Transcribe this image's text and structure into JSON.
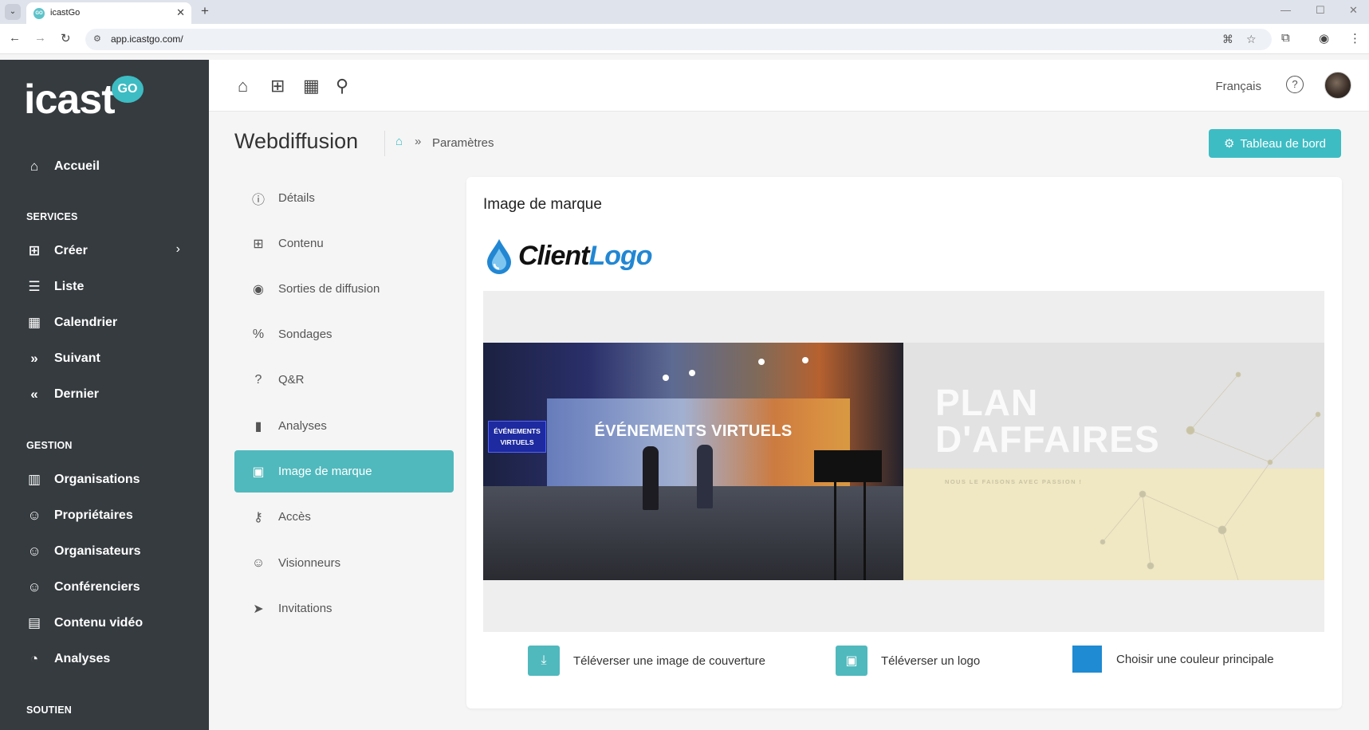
{
  "browser": {
    "tab_title": "icastGo",
    "url": "app.icastgo.com/",
    "favicon_text": "GO"
  },
  "sidebar": {
    "logo_text": "icast",
    "logo_badge": "GO",
    "items_top": [
      {
        "label": "Accueil",
        "icon": "home-icon"
      }
    ],
    "section_services": "SERVICES",
    "items_services": [
      {
        "label": "Créer",
        "icon": "file-plus-icon"
      },
      {
        "label": "Liste",
        "icon": "list-icon"
      },
      {
        "label": "Calendrier",
        "icon": "calendar-icon"
      },
      {
        "label": "Suivant",
        "icon": "chevrons-right-icon"
      },
      {
        "label": "Dernier",
        "icon": "chevrons-left-icon"
      }
    ],
    "section_gestion": "GESTION",
    "items_gestion": [
      {
        "label": "Organisations",
        "icon": "building-icon"
      },
      {
        "label": "Propriétaires",
        "icon": "user-icon"
      },
      {
        "label": "Organisateurs",
        "icon": "user-icon"
      },
      {
        "label": "Conférenciers",
        "icon": "user-icon"
      },
      {
        "label": "Contenu vidéo",
        "icon": "film-icon"
      },
      {
        "label": "Analyses",
        "icon": "pie-chart-icon"
      }
    ],
    "section_soutien": "SOUTIEN"
  },
  "header": {
    "language": "Français"
  },
  "page": {
    "title": "Webdiffusion",
    "breadcrumb_current": "Paramètres",
    "dashboard_button": "Tableau de bord"
  },
  "settings_menu": [
    {
      "label": "Détails",
      "icon": "info-icon",
      "active": false
    },
    {
      "label": "Contenu",
      "icon": "file-plus-icon",
      "active": false
    },
    {
      "label": "Sorties de diffusion",
      "icon": "broadcast-icon",
      "active": false
    },
    {
      "label": "Sondages",
      "icon": "percent-icon",
      "active": false
    },
    {
      "label": "Q&R",
      "icon": "question-icon",
      "active": false
    },
    {
      "label": "Analyses",
      "icon": "bar-chart-icon",
      "active": false
    },
    {
      "label": "Image de marque",
      "icon": "image-icon",
      "active": true
    },
    {
      "label": "Accès",
      "icon": "key-icon",
      "active": false
    },
    {
      "label": "Visionneurs",
      "icon": "users-icon",
      "active": false
    },
    {
      "label": "Invitations",
      "icon": "send-icon",
      "active": false
    }
  ],
  "branding": {
    "title": "Image de marque",
    "logo_text_dark": "Client",
    "logo_text_blue": "Logo",
    "cover_left_sign": "ÉVÉNEMENTS VIRTUELS",
    "cover_left_title": "ÉVÉNEMENTS VIRTUELS",
    "cover_right_title_line1": "PLAN",
    "cover_right_title_line2": "D'AFFAIRES",
    "cover_right_subtitle": "NOUS LE FAISONS AVEC PASSION !",
    "upload_cover_label": "Téléverser une image de couverture",
    "upload_logo_label": "Téléverser un logo",
    "choose_color_label": "Choisir une couleur principale",
    "primary_color": "#1e8bd3"
  },
  "colors": {
    "sidebar_bg": "#353b3f",
    "accent": "#3dbcc3",
    "active_menu": "#50b9bd"
  }
}
